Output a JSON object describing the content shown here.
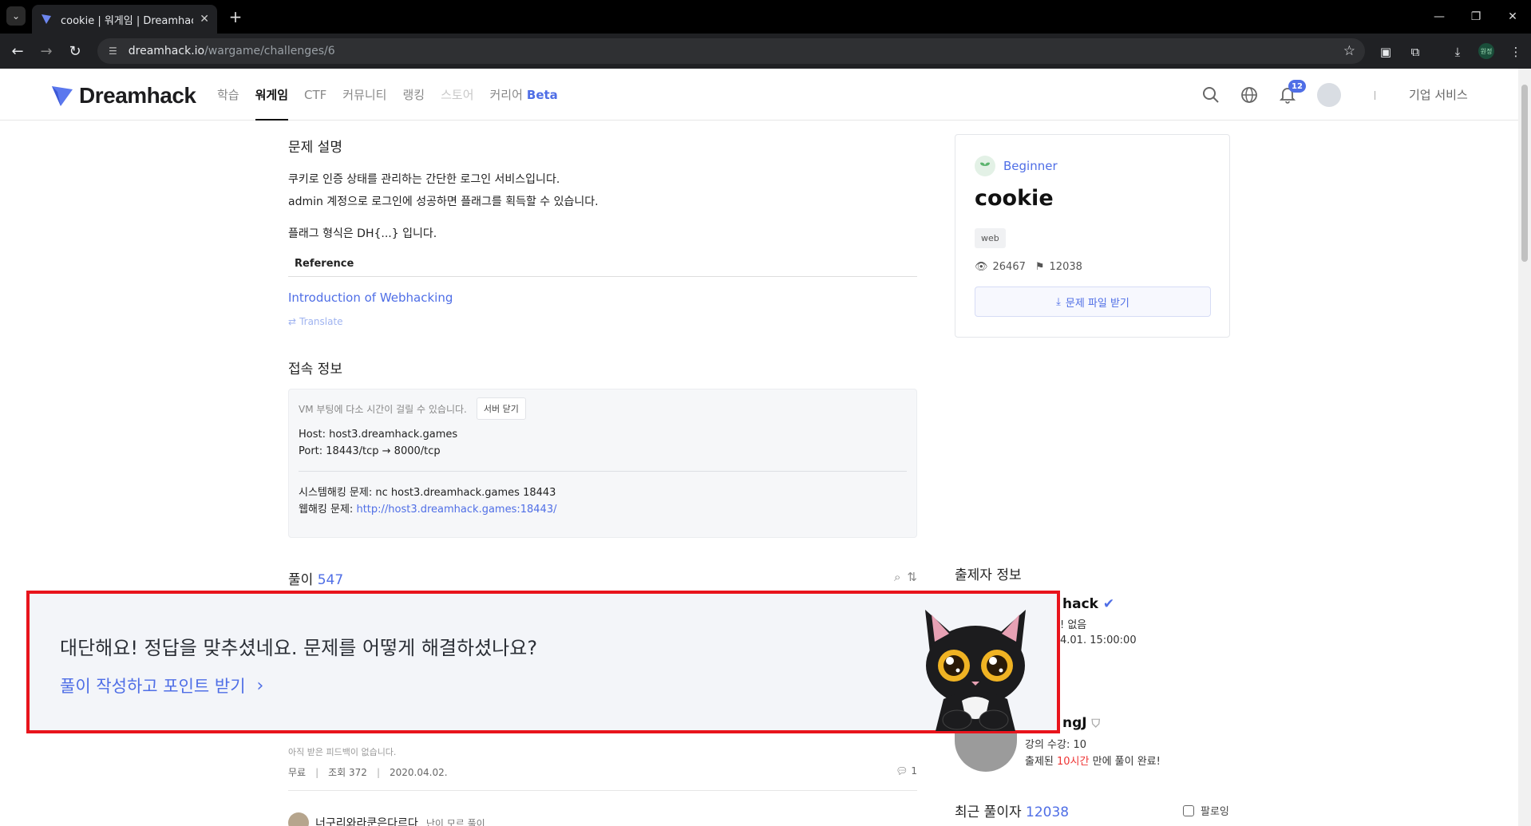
{
  "browser": {
    "tab_title": "cookie | 워게임 | Dreamhack |",
    "url_host": "dreamhack.io",
    "url_path": "/wargame/challenges/6",
    "profile_label": "원정"
  },
  "site": {
    "logo_text": "Dreamhack",
    "nav": [
      {
        "label": "학습"
      },
      {
        "label": "워게임"
      },
      {
        "label": "CTF"
      },
      {
        "label": "커뮤니티"
      },
      {
        "label": "랭킹"
      },
      {
        "label": "스토어"
      },
      {
        "label": "커리어",
        "suffix": "Beta"
      }
    ],
    "notification_count": "12",
    "divider_char": "I",
    "business_label": "기업 서비스"
  },
  "description": {
    "title": "문제 설명",
    "lines": [
      "쿠키로 인증 상태를 관리하는 간단한 로그인 서비스입니다.",
      "admin 계정으로 로그인에 성공하면 플래그를 획득할 수 있습니다."
    ],
    "flag_format": "플래그 형식은 DH{...} 입니다.",
    "reference_label": "Reference",
    "reference_link": "Introduction of Webhacking",
    "translate_label": "Translate"
  },
  "connection": {
    "title": "접속 정보",
    "hint": "VM 부팅에 다소 시간이 걸릴 수 있습니다.",
    "close_server_label": "서버 닫기",
    "host_line": "Host: host3.dreamhack.games",
    "port_line": "Port:  18443/tcp → 8000/tcp",
    "system_line": "시스템해킹 문제: nc host3.dreamhack.games 18443",
    "web_label": "웹해킹 문제: ",
    "web_link": "http://host3.dreamhack.games:18443/"
  },
  "challenge_card": {
    "level": "Beginner",
    "name": "cookie",
    "tag": "web",
    "views": "26467",
    "solves": "12038",
    "download_label": "문제 파일 받기"
  },
  "solutions": {
    "label": "풀이",
    "count": "547",
    "feedback_note": "아직 받은 피드백이 없습니다.",
    "meta": {
      "price": "무료",
      "views": "조회 372",
      "date": "2020.04.02.",
      "comments": "1"
    },
    "next_author": "너구리와라쿤은다르다",
    "next_sub": "난이 모르 풀이"
  },
  "author": {
    "title": "출제자 정보",
    "name_partial": "hack",
    "line1_partial": "! 없음",
    "line2_partial": "4.01. 15:00:00"
  },
  "first_solver": {
    "name_partial": "ngJ",
    "courses": "강의 수강: 10",
    "solved_prefix": "출제된 ",
    "solved_highlight": "10시간",
    "solved_suffix": " 만에 풀이 완료!"
  },
  "recent": {
    "label": "최근 풀이자",
    "count": "12038",
    "follow_label": "팔로잉"
  },
  "banner": {
    "message": "대단해요! 정답을 맞추셨네요. 문제를 어떻게 해결하셨나요?",
    "cta": "풀이 작성하고 포인트 받기"
  },
  "colors": {
    "accent": "#4f6ee6",
    "banner_border": "#e8141c",
    "banner_bg": "#f3f5f9"
  }
}
